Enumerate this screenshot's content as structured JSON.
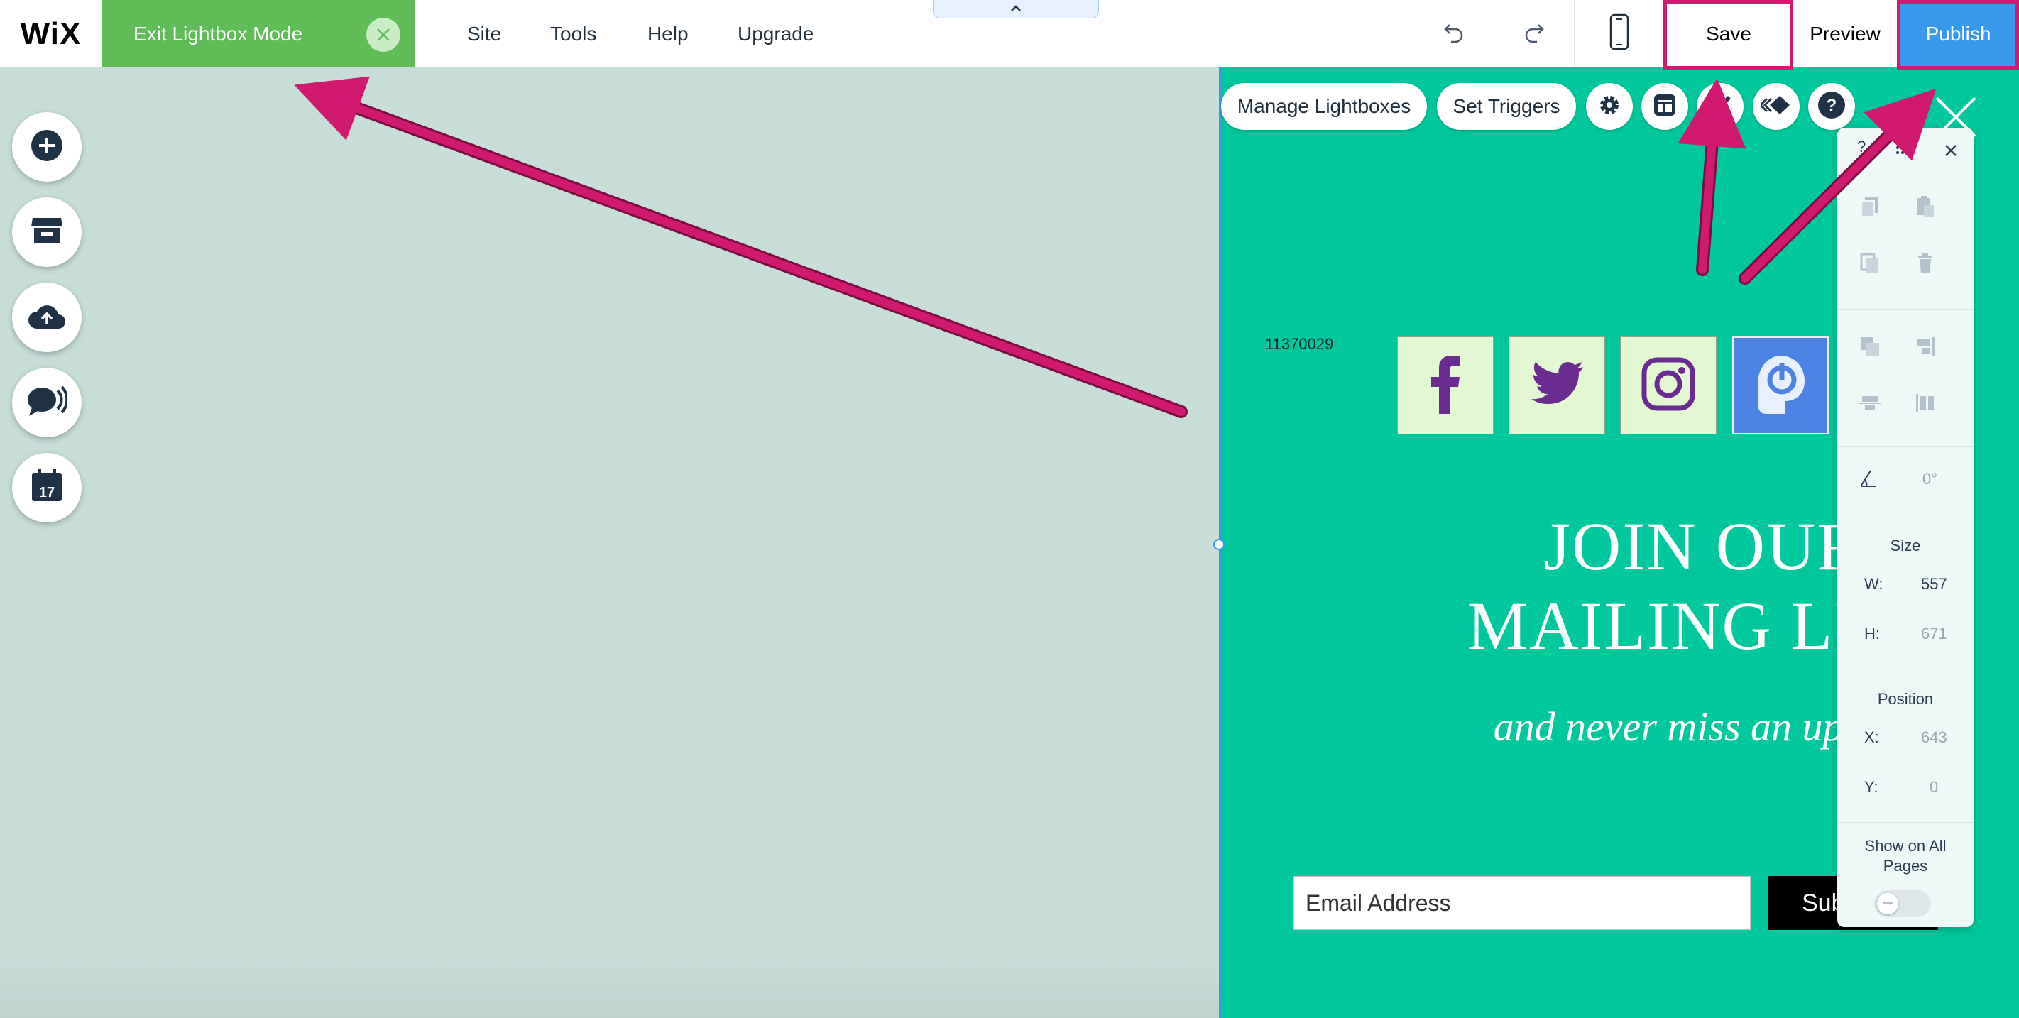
{
  "brand": {
    "logo": "WiX"
  },
  "topbar": {
    "exit_lightbox_label": "Exit Lightbox Mode",
    "menu": [
      {
        "label": "Site"
      },
      {
        "label": "Tools"
      },
      {
        "label": "Help"
      },
      {
        "label": "Upgrade"
      }
    ],
    "save_label": "Save",
    "preview_label": "Preview",
    "publish_label": "Publish",
    "icons": [
      "undo-icon",
      "redo-icon",
      "mobile-view-icon",
      "collapse-chevron-icon"
    ]
  },
  "sidebar": {
    "tools": [
      "add-icon",
      "store-icon",
      "upload-icon",
      "chat-icon",
      "calendar-icon"
    ]
  },
  "lightbox_toolbar": {
    "manage_label": "Manage Lightboxes",
    "triggers_label": "Set Triggers",
    "icons": [
      "settings-icon",
      "layout-icon",
      "design-icon",
      "animation-icon",
      "help-icon"
    ]
  },
  "lightbox": {
    "element_id": "11370029",
    "social_icons": [
      "facebook-icon",
      "twitter-icon",
      "instagram-icon",
      "custom-app-icon"
    ],
    "headline_line1": "JOIN OUR",
    "headline_line2": "MAILING LIST",
    "tagline": "and never miss an update",
    "email_placeholder": "Email Address",
    "subscribe_label": "Subscribe"
  },
  "inspector": {
    "help": "?",
    "rotation_value": "0°",
    "size_title": "Size",
    "width_label": "W:",
    "width_value": "557",
    "height_label": "H:",
    "height_value": "671",
    "position_title": "Position",
    "x_label": "X:",
    "x_value": "643",
    "y_label": "Y:",
    "y_value": "0",
    "show_all_pages": "Show on All Pages",
    "show_all_pages_on": false
  },
  "colors": {
    "stage": "#00c89c",
    "canvas": "#c6ddd8",
    "exit_bar": "#60bc57",
    "publish": "#3899ec",
    "annotation": "#d0196f"
  }
}
